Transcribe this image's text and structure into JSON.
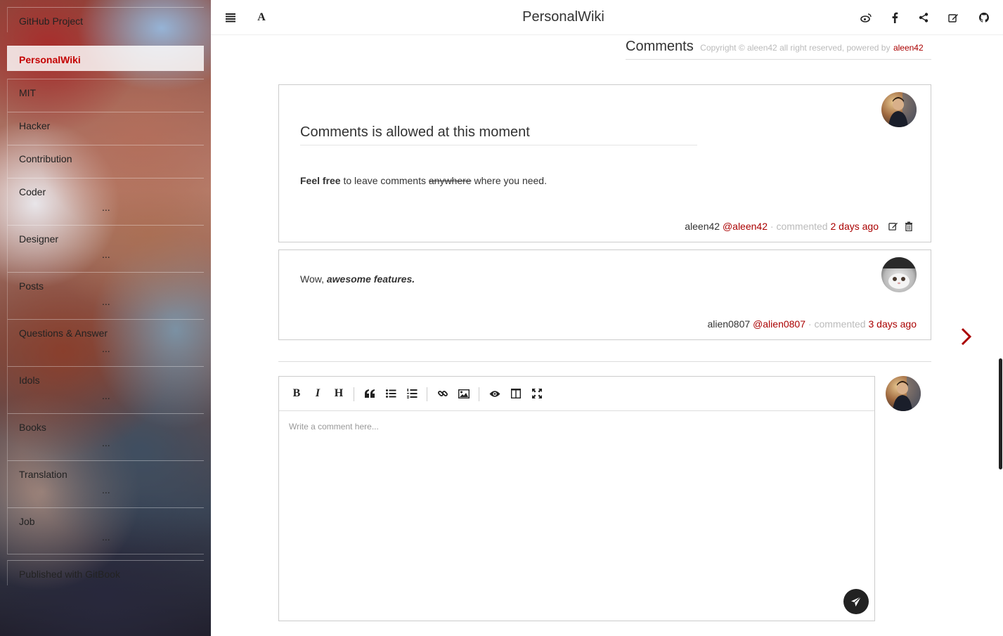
{
  "sidebar": {
    "items": [
      {
        "label": "GitHub Project",
        "dots": ""
      },
      {
        "label": "PersonalWiki",
        "dots": ""
      },
      {
        "label": "MIT",
        "dots": ""
      },
      {
        "label": "Hacker",
        "dots": ""
      },
      {
        "label": "Contribution",
        "dots": ""
      },
      {
        "label": "Coder",
        "dots": "..."
      },
      {
        "label": "Designer",
        "dots": "..."
      },
      {
        "label": "Posts",
        "dots": "..."
      },
      {
        "label": "Questions & Answer",
        "dots": "..."
      },
      {
        "label": "Idols",
        "dots": "..."
      },
      {
        "label": "Books",
        "dots": "..."
      },
      {
        "label": "Translation",
        "dots": "..."
      },
      {
        "label": "Job",
        "dots": "..."
      },
      {
        "label": "Published with GitBook",
        "dots": ""
      }
    ],
    "active_index": 1
  },
  "header": {
    "title": "PersonalWiki",
    "left_icons": [
      "menu-icon",
      "font-icon"
    ],
    "right_icons": [
      "weibo-icon",
      "facebook-icon",
      "share-icon",
      "edit-icon",
      "github-icon"
    ]
  },
  "comments_section": {
    "title": "Comments",
    "copyright": "Copyright © aleen42 all right reserved, powered by",
    "powered_link": "aleen42"
  },
  "comments": [
    {
      "heading": "Comments is allowed at this moment",
      "body_bold": "Feel free",
      "body_mid": " to leave comments ",
      "body_strike": "anywhere",
      "body_end": " where you need.",
      "author": "aleen42",
      "handle": "@aleen42",
      "action": "commented",
      "time": "2 days ago"
    },
    {
      "body_start": "Wow, ",
      "body_emph": "awesome features.",
      "author": "alien0807",
      "handle": "@alien0807",
      "action": "commented",
      "time": "3 days ago"
    }
  ],
  "editor": {
    "placeholder": "Write a comment here...",
    "toolbar": [
      "B",
      "I",
      "H"
    ]
  },
  "colors": {
    "accent": "#aa0000",
    "muted": "#bbbbbb",
    "text": "#333333"
  }
}
